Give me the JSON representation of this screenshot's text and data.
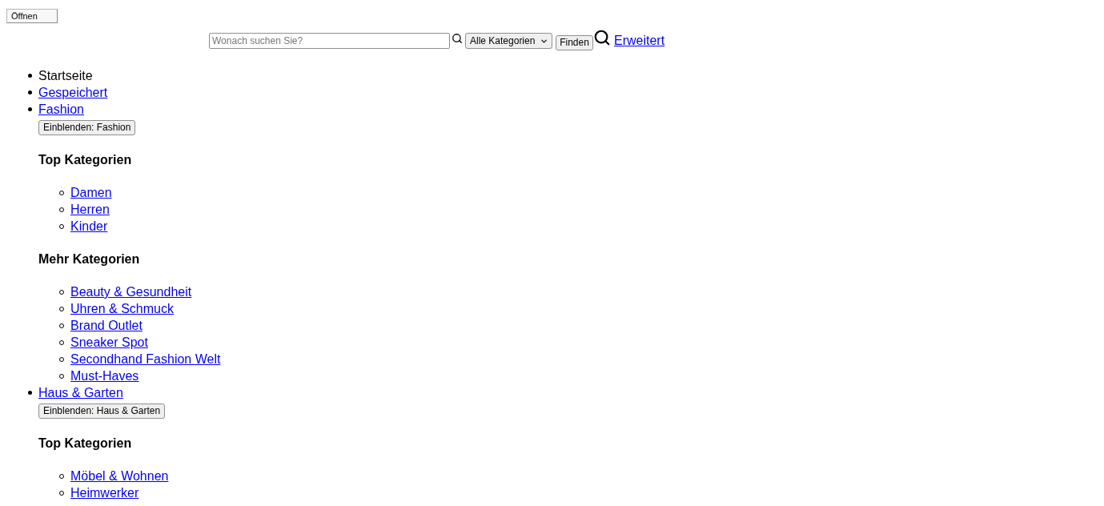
{
  "header": {
    "open_button": "Öffnen"
  },
  "search": {
    "placeholder": "Wonach suchen Sie?",
    "category": "Alle Kategorien",
    "submit": "Finden",
    "advanced_link": "Erweitert"
  },
  "nav": [
    {
      "kind": "text",
      "label": "Startseite"
    },
    {
      "kind": "link",
      "label": "Gespeichert"
    },
    {
      "kind": "link",
      "label": "Fashion",
      "toggle": "Einblenden: Fashion",
      "sections": [
        {
          "heading": "Top Kategorien",
          "links": [
            "Damen",
            "Herren",
            "Kinder"
          ]
        },
        {
          "heading": "Mehr Kategorien",
          "links": [
            "Beauty & Gesundheit",
            "Uhren & Schmuck",
            "Brand Outlet",
            "Sneaker Spot",
            "Secondhand Fashion Welt",
            "Must-Haves"
          ]
        }
      ]
    },
    {
      "kind": "link",
      "label": "Haus & Garten",
      "toggle": "Einblenden: Haus & Garten",
      "sections": [
        {
          "heading": "Top Kategorien",
          "links": [
            "Möbel & Wohnen",
            "Heimwerker"
          ]
        }
      ]
    }
  ]
}
